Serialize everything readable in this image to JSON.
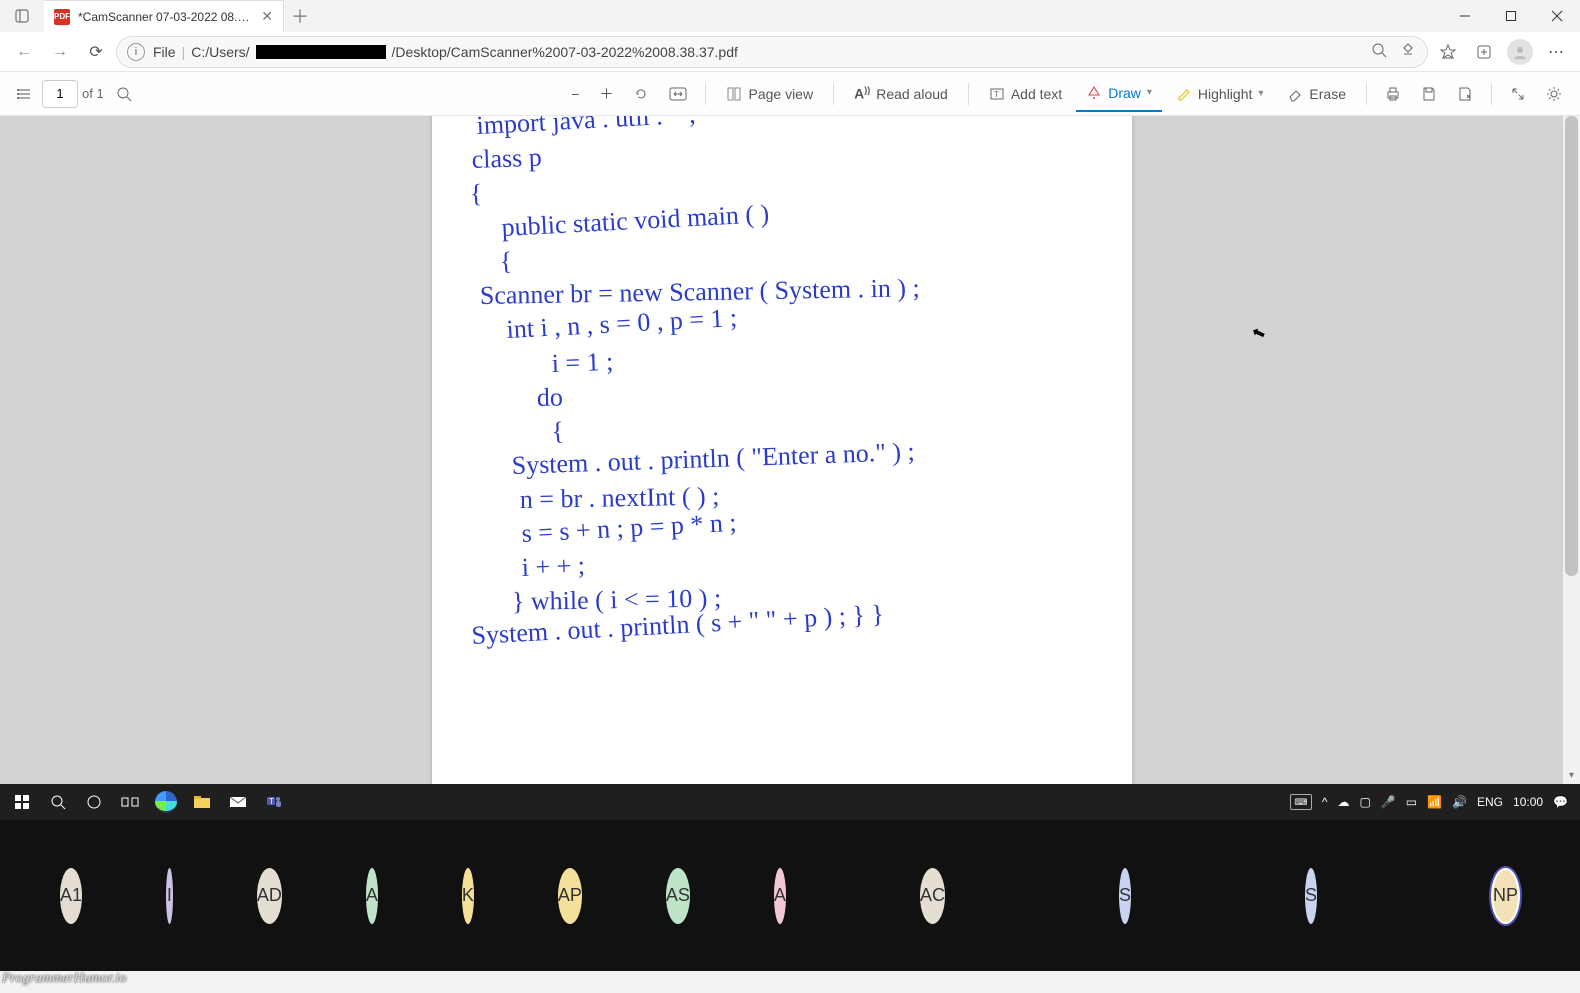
{
  "titlebar": {
    "tab_title": "*CamScanner 07-03-2022 08.38…"
  },
  "urlbar": {
    "scheme_label": "File",
    "path_pre": "C:/Users/",
    "path_post": "/Desktop/CamScanner%2007-03-2022%2008.38.37.pdf"
  },
  "pdfbar": {
    "page_current": "1",
    "page_total": "of 1",
    "page_view": "Page view",
    "read_aloud": "Read aloud",
    "add_text": "Add text",
    "draw": "Draw",
    "highlight": "Highlight",
    "erase": "Erase"
  },
  "handwriting": {
    "lines": [
      "import  java . util . * ;",
      "class  p",
      "{",
      "   public  static  void  main ( )",
      "   {",
      "   Scanner  br =  new  Scanner ( System . in ) ;",
      "   int  i , n ,  s = 0 ,  p = 1 ;",
      "       i = 1 ;",
      "      do",
      "       {",
      "   System . out . println ( \"Enter  a  no.\" ) ;",
      "   n = br . nextInt ( ) ;",
      "   s = s + n ;   p = p * n ;",
      "   i + + ;",
      "   } while ( i  < =  10 ) ;",
      "System . out . println ( s + \"   \" + p ) ;  }  }"
    ]
  },
  "taskbar": {
    "lang": "ENG",
    "time": "10:00"
  },
  "participants": [
    {
      "initials": "A1",
      "bg": "#e4ded2"
    },
    {
      "initials": "I",
      "bg": "#cfc1e6"
    },
    {
      "initials": "AD",
      "bg": "#e4ded2"
    },
    {
      "initials": "A",
      "bg": "#bfe3c6"
    },
    {
      "initials": "K",
      "bg": "#f5e09a"
    },
    {
      "initials": "AP",
      "bg": "#f5e09a"
    },
    {
      "initials": "AS",
      "bg": "#bfe3c6"
    },
    {
      "initials": "A",
      "bg": "#f3c6d6"
    },
    {
      "initials": "AC",
      "bg": "#e4ded2"
    },
    {
      "initials": "S",
      "bg": "#c8d4ef"
    },
    {
      "initials": "S",
      "bg": "#c8d4ef"
    },
    {
      "initials": "NP",
      "bg": "#f3e2b8"
    }
  ],
  "watermark": "ProgrammerHumor.io"
}
